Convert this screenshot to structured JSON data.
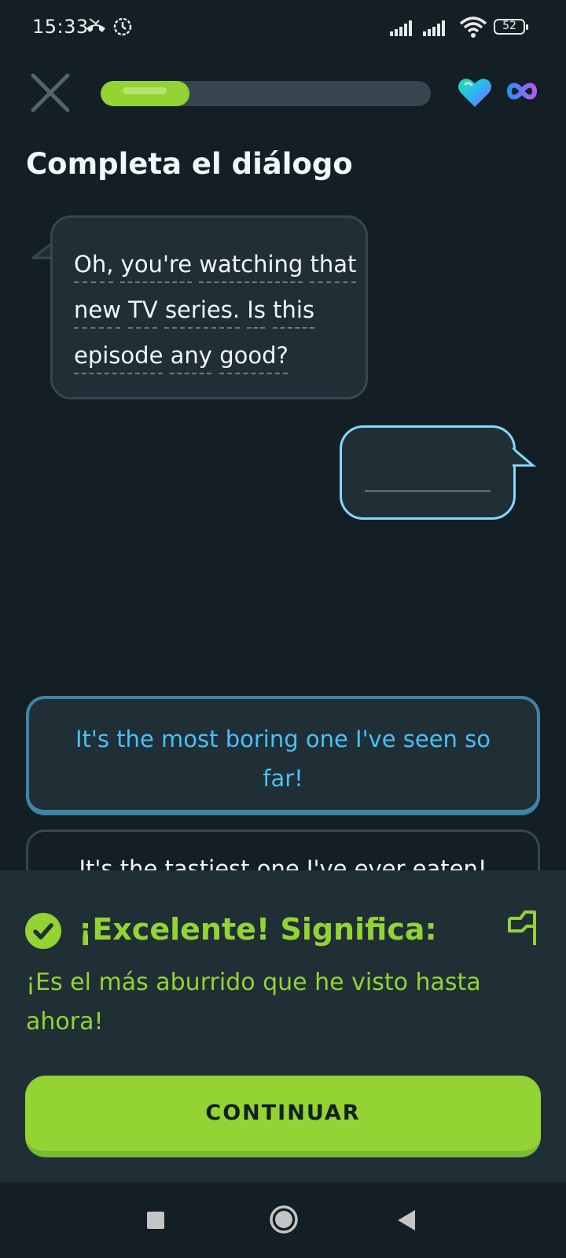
{
  "status_bar": {
    "time": "15:33",
    "battery": "52"
  },
  "progress": {
    "value": 0.27
  },
  "title": "Completa el diálogo",
  "prompt": {
    "words": [
      "Oh,",
      "you're",
      "watching",
      "that",
      "new",
      "TV",
      "series.",
      "Is",
      "this",
      "episode",
      "any",
      "good?"
    ]
  },
  "options": [
    {
      "text": "It's the most boring one I've seen so far!",
      "state": "selected"
    },
    {
      "text": "It's the tastiest one I've ever eaten!",
      "state": "default"
    }
  ],
  "feedback": {
    "title": "¡Excelente! Significa:",
    "translation": "¡Es el más aburrido que he visto hasta ahora!",
    "continue_label": "CONTINUAR"
  },
  "colors": {
    "accent_green": "#93d333",
    "selected_blue": "#49c0f8",
    "background": "#131f24"
  },
  "icons": [
    "close-icon",
    "heart-icon",
    "infinity-icon",
    "check-circle-icon",
    "flag-icon",
    "nav-recents-icon",
    "nav-home-icon",
    "nav-back-icon"
  ]
}
